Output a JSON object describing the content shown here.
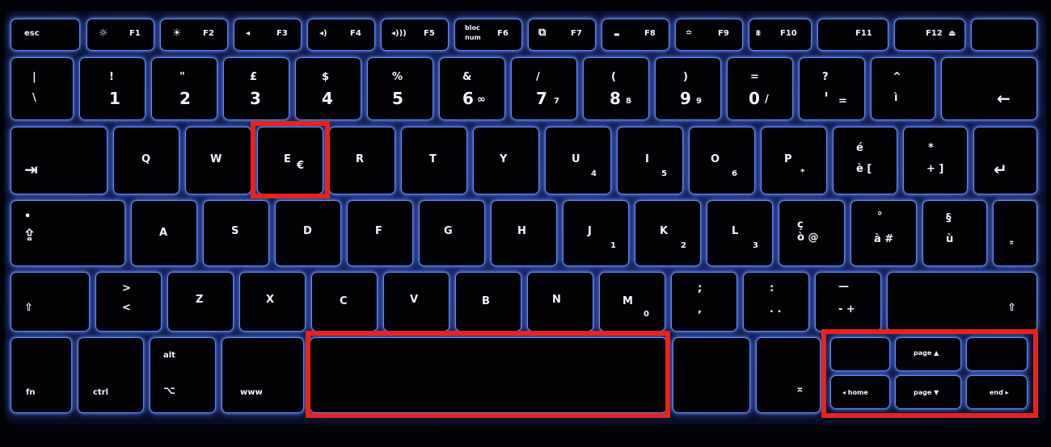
{
  "keyboard": {
    "row_f": {
      "esc": "esc",
      "f1": "F1",
      "f1_icon": "☼",
      "f2": "F2",
      "f2_icon": "☀",
      "f3": "F3",
      "f3_icon": "◂",
      "f4": "F4",
      "f4_icon": "◂)",
      "f5": "F5",
      "f5_icon": "◂)))",
      "f6": "F6",
      "f6_icon_top": "bloc",
      "f6_icon_bottom": "num",
      "f7": "F7",
      "f7_icon": "⧉",
      "f8": "F8",
      "f8_icon": "▬",
      "f9": "F9",
      "f9_icon": "≏",
      "f10": "F10",
      "f10_icon": "⩨",
      "f11": "F11",
      "f12": "F12",
      "eject_icon": "⏏"
    },
    "row_num": [
      {
        "top": "|",
        "bottom": "\\",
        "sub": ""
      },
      {
        "top": "!",
        "bottom": "1",
        "sub": ""
      },
      {
        "top": "\"",
        "bottom": "2",
        "sub": ""
      },
      {
        "top": "£",
        "bottom": "3",
        "sub": ""
      },
      {
        "top": "$",
        "bottom": "4",
        "sub": ""
      },
      {
        "top": "%",
        "bottom": "5",
        "sub": ""
      },
      {
        "top": "&",
        "bottom": "6",
        "sub": "∞"
      },
      {
        "top": "/",
        "bottom": "7",
        "sub": "7"
      },
      {
        "top": "(",
        "bottom": "8",
        "sub": "8"
      },
      {
        "top": ")",
        "bottom": "9",
        "sub": "9"
      },
      {
        "top": "=",
        "bottom": "0",
        "sub": "/"
      },
      {
        "top": "?",
        "bottom": "'",
        "sub": "="
      },
      {
        "top": "^",
        "bottom": "ì",
        "sub": ""
      }
    ],
    "backspace_icon": "←",
    "tab_icon": "⇥",
    "row_q": [
      {
        "main": "Q",
        "sub": ""
      },
      {
        "main": "W",
        "sub": ""
      },
      {
        "main": "E",
        "sub": "€"
      },
      {
        "main": "R",
        "sub": ""
      },
      {
        "main": "T",
        "sub": ""
      },
      {
        "main": "Y",
        "sub": ""
      },
      {
        "main": "U",
        "sub": "4"
      },
      {
        "main": "I",
        "sub": "5"
      },
      {
        "main": "O",
        "sub": "6"
      },
      {
        "main": "P",
        "sub": "*"
      }
    ],
    "key_e_grave": {
      "top": "é",
      "bottom": "è [",
      "sub": ""
    },
    "key_plus": {
      "top": "*",
      "bottom": "+ ]",
      "sub": ""
    },
    "return_icon": "↵",
    "caps_icon": "⇪",
    "caps_dot": "•",
    "row_a": [
      {
        "main": "A",
        "sub": ""
      },
      {
        "main": "S",
        "sub": ""
      },
      {
        "main": "D",
        "sub": ""
      },
      {
        "main": "F",
        "sub": ""
      },
      {
        "main": "G",
        "sub": ""
      },
      {
        "main": "H",
        "sub": ""
      },
      {
        "main": "J",
        "sub": "1"
      },
      {
        "main": "K",
        "sub": "2"
      },
      {
        "main": "L",
        "sub": "3"
      }
    ],
    "key_c_cedilla": {
      "top": "ç",
      "bottom": "ò @"
    },
    "key_degree": {
      "top": "°",
      "bottom": "à #"
    },
    "key_section": {
      "top": "§",
      "bottom": "ù"
    },
    "enter_icon": "⌅",
    "shift_icon": "⇧",
    "key_angle": {
      "top": ">",
      "bottom": "<"
    },
    "row_z": [
      {
        "main": "Z",
        "sub": ""
      },
      {
        "main": "X",
        "sub": ""
      },
      {
        "main": "C",
        "sub": ""
      },
      {
        "main": "V",
        "sub": ""
      },
      {
        "main": "B",
        "sub": ""
      },
      {
        "main": "N",
        "sub": ""
      },
      {
        "main": "M",
        "sub": "0"
      }
    ],
    "key_semicolon": {
      "top": ";",
      "bottom": ","
    },
    "key_colon": {
      "top": ":",
      "bottom": ". ."
    },
    "key_dash": {
      "top": "—",
      "bottom": "- +"
    },
    "fn": "fn",
    "ctrl": "ctrl",
    "alt_top": "alt",
    "alt_bottom": "⌥",
    "cmd": "www",
    "enter_small_icon": "⌅",
    "page_up": "page ▲",
    "home": "◂ home",
    "page_down": "page ▼",
    "end": "end ▸"
  },
  "colors": {
    "highlight": "#e8231b",
    "backlight": "#5e88ff"
  }
}
